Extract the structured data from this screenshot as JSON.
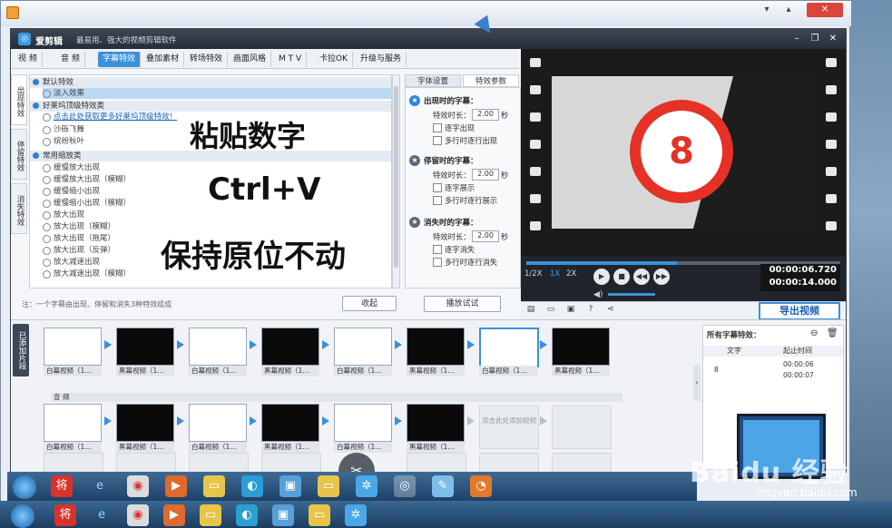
{
  "app": {
    "name": "爱剪辑",
    "slogan": "最易用、强大的视频剪辑软件"
  },
  "tabs": [
    "视 频",
    "音 频",
    "字幕特效",
    "叠加素材",
    "转场特效",
    "画面风格",
    "M T V",
    "卡拉OK",
    "升级与服务"
  ],
  "active_tab": "字幕特效",
  "category_tabs": [
    "出现特效",
    "停留特效",
    "消失特效"
  ],
  "effect_groups": {
    "default": {
      "title": "默认特效",
      "items": [
        "淡入效果"
      ]
    },
    "hollywood": {
      "title": "好莱坞顶级特效类",
      "link": "点击此处获取更多好莱坞顶级特效！",
      "items": [
        "沙砾飞舞",
        "缤纷秋叶"
      ]
    },
    "zoom": {
      "title": "常用缩放类",
      "items": [
        "缓慢放大出现",
        "缓慢放大出现（模糊）",
        "缓慢缩小出现",
        "缓慢缩小出现（模糊）",
        "放大出现",
        "放大出现（模糊）",
        "放大出现（拖尾）",
        "放大出现（反弹）",
        "放大减速出现",
        "放大减速出现（模糊）"
      ]
    }
  },
  "overlays": {
    "line1": "粘贴数字",
    "line2": "Ctrl+V",
    "line3": "保持原位不动"
  },
  "note": "注：一个字幕由出现、停留和消失3种特效组成",
  "collapse_button": "收起",
  "settings": {
    "tabs": [
      "字体设置",
      "特效参数"
    ],
    "appear": {
      "title": "出现时的字幕：",
      "duration_label": "特效时长：",
      "duration": "2.00",
      "unit": "秒",
      "opt1": "逐字出现",
      "opt2": "多行时逐行出现"
    },
    "stay": {
      "title": "停留时的字幕：",
      "duration_label": "特效时长：",
      "duration": "2.00",
      "unit": "秒",
      "opt1": "逐字展示",
      "opt2": "多行时逐行展示"
    },
    "disappear": {
      "title": "消失时的字幕：",
      "duration_label": "特效时长：",
      "duration": "2.00",
      "unit": "秒",
      "opt1": "逐字消失",
      "opt2": "多行时逐行消失"
    },
    "preview_button": "播放试试"
  },
  "video": {
    "counter": "8"
  },
  "player": {
    "speeds": [
      "1/2X",
      "1X",
      "2X"
    ],
    "active_speed": "1X",
    "current_time": "00:00:06.720",
    "total_time": "00:00:14.000",
    "progress": 0.48,
    "export_label": "导出视频"
  },
  "timeline": {
    "added_label": "已添加片段",
    "clips": [
      "白幕视频（1…",
      "黑幕视频（1…",
      "白幕视频（1…",
      "黑幕视频（1…",
      "白幕视频（1…",
      "黑幕视频（1…",
      "白幕视频（1…",
      "黑幕视频（1…"
    ],
    "audio_label": "音 频",
    "clips_row2": [
      "白幕视频（1…",
      "黑幕视频（1…",
      "白幕视频（1…",
      "黑幕视频（1…",
      "白幕视频（1…",
      "黑幕视频（1…"
    ],
    "add_hint": "双击此处添加视频"
  },
  "subtitles_panel": {
    "title": "所有字幕特效：",
    "col_text": "文字",
    "col_time": "起止时间",
    "rows": [
      {
        "text": "8",
        "start": "00:00:06",
        "end": "00:00:07"
      }
    ]
  },
  "watermark": {
    "brand": "Baidu 经验",
    "url": "jingyan.baidu.com"
  },
  "colors": {
    "accent": "#3a91d8",
    "title_bar": "#2e3643",
    "counter_red": "#e53126"
  },
  "taskbar_icons": [
    "start-icon",
    "app-icon-将",
    "ie-icon",
    "chrome-icon",
    "player-icon",
    "folder-icon",
    "browser-icon",
    "monitor-icon",
    "folder-icon",
    "pinwheel-icon",
    "aijianji-icon",
    "paint-icon",
    "firefox-icon"
  ]
}
